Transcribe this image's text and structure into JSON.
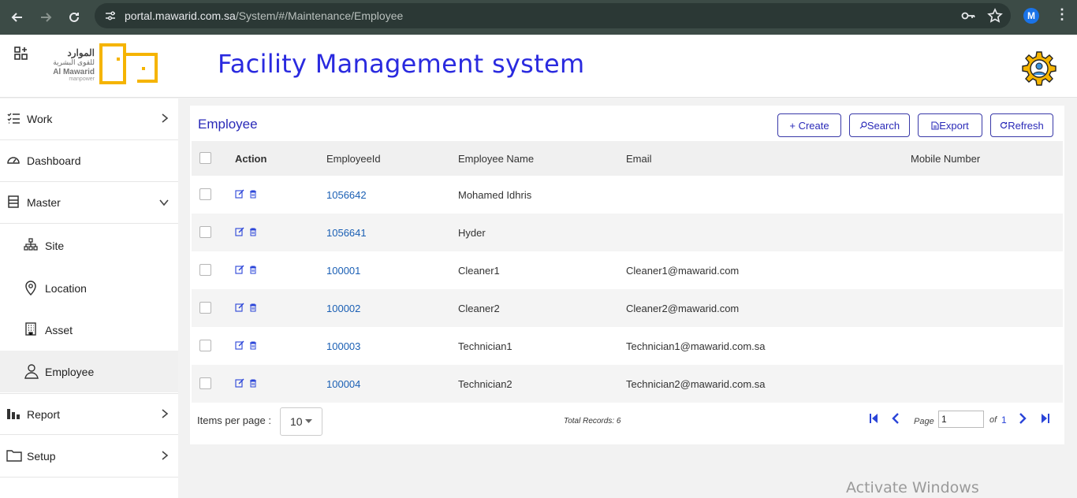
{
  "browser": {
    "url_host": "portal.mawarid.com.sa",
    "url_path": "/System/#/Maintenance/Employee",
    "profile_initial": "M"
  },
  "header": {
    "logo_arabic": "الموارد",
    "logo_arabic_sub": "للقوى البشرية",
    "logo_english": "Al Mawarid",
    "logo_english_sub": "manpower",
    "title": "Facility Management system"
  },
  "sidebar": {
    "items": [
      {
        "label": "Work",
        "icon": "checklist-icon"
      },
      {
        "label": "Dashboard",
        "icon": "dashboard-gauge-icon"
      },
      {
        "label": "Master",
        "icon": "list-box-icon"
      },
      {
        "label": "Site",
        "icon": "sitemap-icon"
      },
      {
        "label": "Location",
        "icon": "map-pin-icon"
      },
      {
        "label": "Asset",
        "icon": "building-icon"
      },
      {
        "label": "Employee",
        "icon": "user-icon"
      },
      {
        "label": "Report",
        "icon": "bar-chart-icon"
      },
      {
        "label": "Setup",
        "icon": "folder-icon"
      }
    ]
  },
  "panel": {
    "title": "Employee",
    "buttons": {
      "create": "+ Create",
      "search": "Search",
      "export": "Export",
      "refresh": "Refresh"
    },
    "columns": [
      "Action",
      "EmployeeId",
      "Employee Name",
      "Email",
      "Mobile Number"
    ],
    "rows": [
      {
        "id": "1056642",
        "name": "Mohamed Idhris",
        "email": "",
        "mobile": ""
      },
      {
        "id": "1056641",
        "name": "Hyder",
        "email": "",
        "mobile": ""
      },
      {
        "id": "100001",
        "name": "Cleaner1",
        "email": "Cleaner1@mawarid.com",
        "mobile": ""
      },
      {
        "id": "100002",
        "name": "Cleaner2",
        "email": "Cleaner2@mawarid.com",
        "mobile": ""
      },
      {
        "id": "100003",
        "name": "Technician1",
        "email": "Technician1@mawarid.com.sa",
        "mobile": ""
      },
      {
        "id": "100004",
        "name": "Technician2",
        "email": "Technician2@mawarid.com.sa",
        "mobile": ""
      }
    ],
    "footer": {
      "items_per_page_label": "Items per page :",
      "items_per_page": "10",
      "total_records": "Total Records: 6",
      "page_label": "Page",
      "page_value": "1",
      "of_label": "of",
      "page_total": "1"
    }
  },
  "watermark": "Activate Windows",
  "colors": {
    "accent": "#2a2adf",
    "link": "#1a5fb4",
    "logo": "#f5b400"
  }
}
